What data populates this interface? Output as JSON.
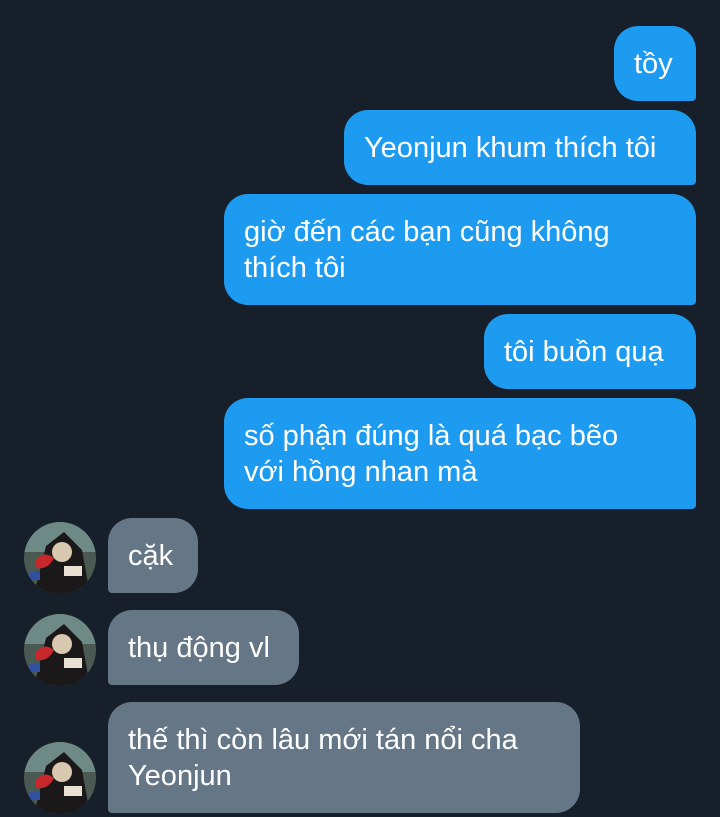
{
  "conversation": {
    "messages": [
      {
        "direction": "outgoing",
        "text": "tồy"
      },
      {
        "direction": "outgoing",
        "text": "Yeonjun khum thích tôi"
      },
      {
        "direction": "outgoing",
        "text": "giờ đến các bạn cũng không\nthích tôi"
      },
      {
        "direction": "outgoing",
        "text": "tôi buồn quạ"
      },
      {
        "direction": "outgoing",
        "text": "số phận đúng là quá bạc bẽo\nvới hồng nhan mà"
      },
      {
        "direction": "incoming",
        "text": "cặk",
        "avatar": "cartoon-avatar"
      },
      {
        "direction": "incoming",
        "text": "thụ động vl",
        "avatar": "cartoon-avatar"
      },
      {
        "direction": "incoming",
        "text": "thế thì còn lâu mới tán nổi cha\nYeonjun",
        "avatar": "cartoon-avatar"
      }
    ]
  },
  "colors": {
    "background": "#17202a",
    "outgoing_bubble": "#1d9bf0",
    "incoming_bubble": "#657786",
    "text": "#ffffff"
  }
}
